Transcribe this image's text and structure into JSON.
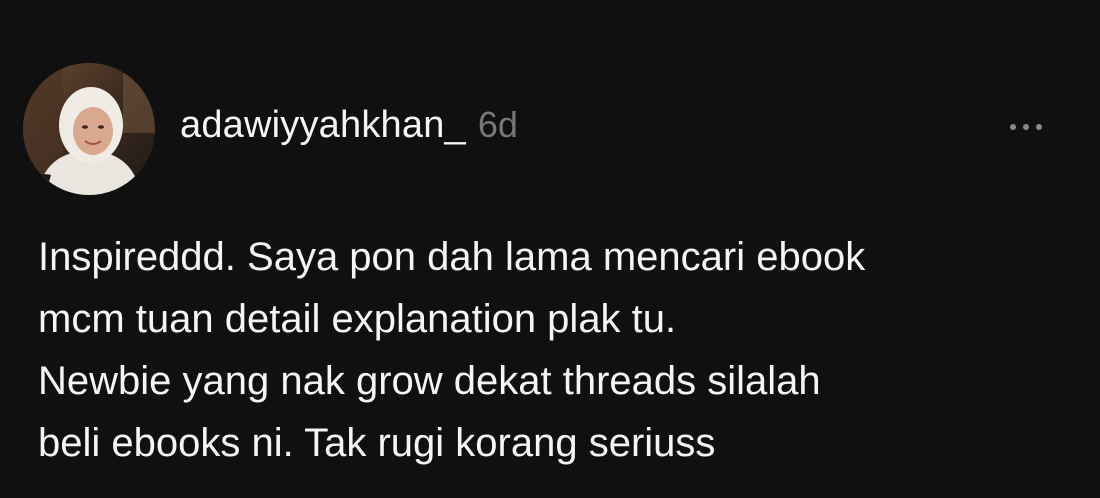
{
  "post": {
    "author": {
      "username": "adawiyyahkhan_",
      "timestamp": "6d"
    },
    "more_icon": "more-horizontal-icon",
    "text_lines": [
      "Inspireddd. Saya pon dah lama mencari ebook",
      "mcm tuan detail explanation plak tu.",
      "Newbie yang nak grow dekat threads silalah",
      "beli ebooks ni. Tak rugi korang seriuss"
    ]
  },
  "colors": {
    "background": "#101010",
    "text": "#f3f5f7",
    "muted": "#777777"
  }
}
